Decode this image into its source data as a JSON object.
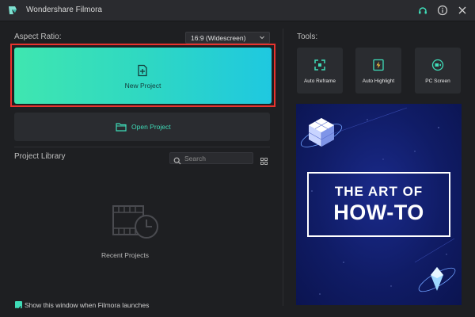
{
  "window": {
    "title": "Wondershare Filmora"
  },
  "titlebar_icons": [
    "headset-icon",
    "info-icon",
    "close-icon"
  ],
  "aspect_ratio": {
    "label": "Aspect Ratio:",
    "selected": "16:9 (Widescreen)"
  },
  "new_project": {
    "label": "New Project"
  },
  "open_project": {
    "label": "Open Project"
  },
  "library": {
    "title": "Project Library",
    "search_placeholder": "Search",
    "empty_label": "Recent Projects"
  },
  "startup": {
    "checked": true,
    "label": "Show this window when Filmora launches"
  },
  "tools": {
    "label": "Tools:",
    "items": [
      {
        "label": "Auto Reframe",
        "icon": "reframe-icon"
      },
      {
        "label": "Auto Highlight",
        "icon": "highlight-icon"
      },
      {
        "label": "PC Screen",
        "icon": "screen-record-icon"
      }
    ]
  },
  "banner": {
    "line1": "THE ART OF",
    "line2": "HOW-TO"
  },
  "colors": {
    "accent": "#3fdcb8",
    "highlight_border": "#e8332e",
    "background": "#1e1f22"
  }
}
